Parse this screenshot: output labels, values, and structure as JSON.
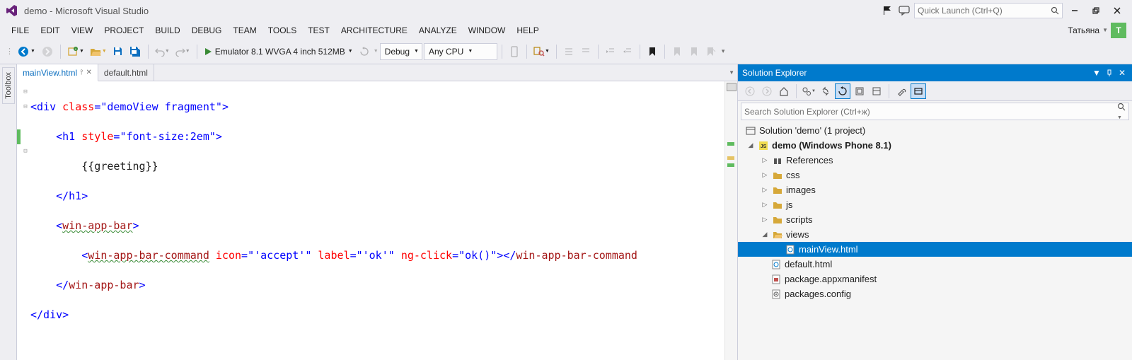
{
  "title": "demo - Microsoft Visual Studio",
  "quick_launch_placeholder": "Quick Launch (Ctrl+Q)",
  "menu": [
    "FILE",
    "EDIT",
    "VIEW",
    "PROJECT",
    "BUILD",
    "DEBUG",
    "TEAM",
    "TOOLS",
    "TEST",
    "ARCHITECTURE",
    "ANALYZE",
    "WINDOW",
    "HELP"
  ],
  "user": {
    "name": "Татьяна",
    "initial": "T"
  },
  "toolbar": {
    "emulator": "Emulator 8.1 WVGA 4 inch 512MB",
    "config": "Debug",
    "platform": "Any CPU"
  },
  "left_tabs": [
    "Toolbox"
  ],
  "doc_tabs": [
    {
      "label": "mainView.html",
      "active": true,
      "pinned": true
    },
    {
      "label": "default.html",
      "active": false,
      "pinned": false
    }
  ],
  "code": {
    "l1": {
      "p1": "<div ",
      "attr": "class",
      "eq": "=",
      "val": "\"demoView fragment\"",
      "p2": ">"
    },
    "l2": {
      "indent": "    ",
      "p1": "<h1 ",
      "attr": "style",
      "eq": "=",
      "val": "\"font-size:2em\"",
      "p2": ">"
    },
    "l3": {
      "indent": "        ",
      "txt": "{{greeting}}"
    },
    "l4": {
      "indent": "    ",
      "p1": "</h1>"
    },
    "l5": {
      "indent": "    ",
      "p1": "<",
      "tag": "win-app-bar",
      "p2": ">"
    },
    "l6": {
      "indent": "        ",
      "p1": "<",
      "tag": "win-app-bar-command",
      "sp": " ",
      "a1": "icon",
      "eq1": "=",
      "v1": "\"'accept'\"",
      "sp2": " ",
      "a2": "label",
      "eq2": "=",
      "v2": "\"'ok'\"",
      "sp3": " ",
      "a3": "ng-click",
      "eq3": "=",
      "v3": "\"ok()\"",
      "p2": "></",
      "tag2": "win-app-bar-command"
    },
    "l7": {
      "indent": "    ",
      "p1": "</",
      "tag": "win-app-bar",
      "p2": ">"
    },
    "l8": {
      "p1": "</div>"
    }
  },
  "solution_explorer": {
    "title": "Solution Explorer",
    "search_placeholder": "Search Solution Explorer (Ctrl+ж)",
    "solution": "Solution 'demo' (1 project)",
    "project": "demo (Windows Phone 8.1)",
    "nodes": {
      "references": "References",
      "css": "css",
      "images": "images",
      "js": "js",
      "scripts": "scripts",
      "views": "views",
      "mainView": "mainView.html",
      "default": "default.html",
      "manifest": "package.appxmanifest",
      "packages": "packages.config"
    }
  }
}
